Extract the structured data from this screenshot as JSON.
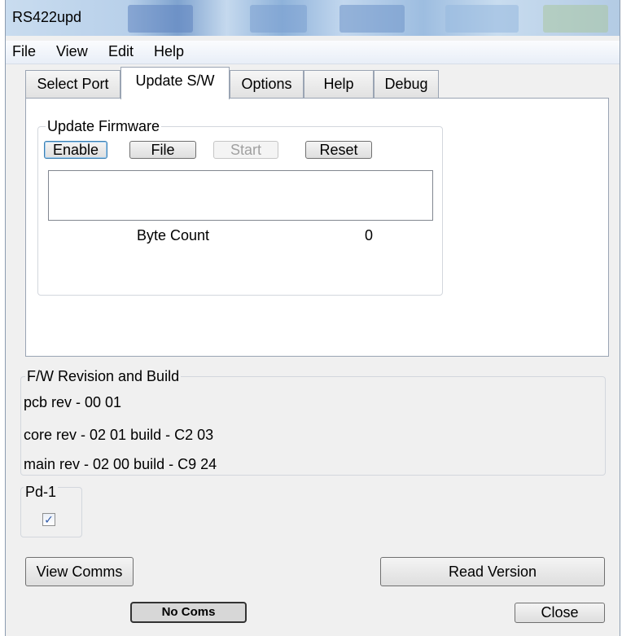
{
  "window": {
    "title": "RS422upd"
  },
  "menu": [
    "File",
    "View",
    "Edit",
    "Help"
  ],
  "tabs": [
    {
      "label": "Select Port"
    },
    {
      "label": "Update S/W",
      "active": true
    },
    {
      "label": "Options"
    },
    {
      "label": "Help"
    },
    {
      "label": "Debug"
    }
  ],
  "update_firmware": {
    "legend": "Update Firmware",
    "enable_label": "Enable",
    "file_label": "File",
    "start_label": "Start",
    "reset_label": "Reset",
    "byte_count_label": "Byte Count",
    "byte_count_value": "0"
  },
  "fw_revision": {
    "legend": "F/W Revision and Build",
    "pcb": "pcb rev - 00 01",
    "core": "core rev - 02 01  build - C2 03",
    "main": "main rev - 02 00  build - C9 24"
  },
  "pd1": {
    "legend": "Pd-1",
    "checked": true,
    "check_glyph": "✓"
  },
  "buttons": {
    "view_comms": "View Comms",
    "read_version": "Read Version",
    "close": "Close"
  },
  "status": {
    "text": "No Coms"
  }
}
